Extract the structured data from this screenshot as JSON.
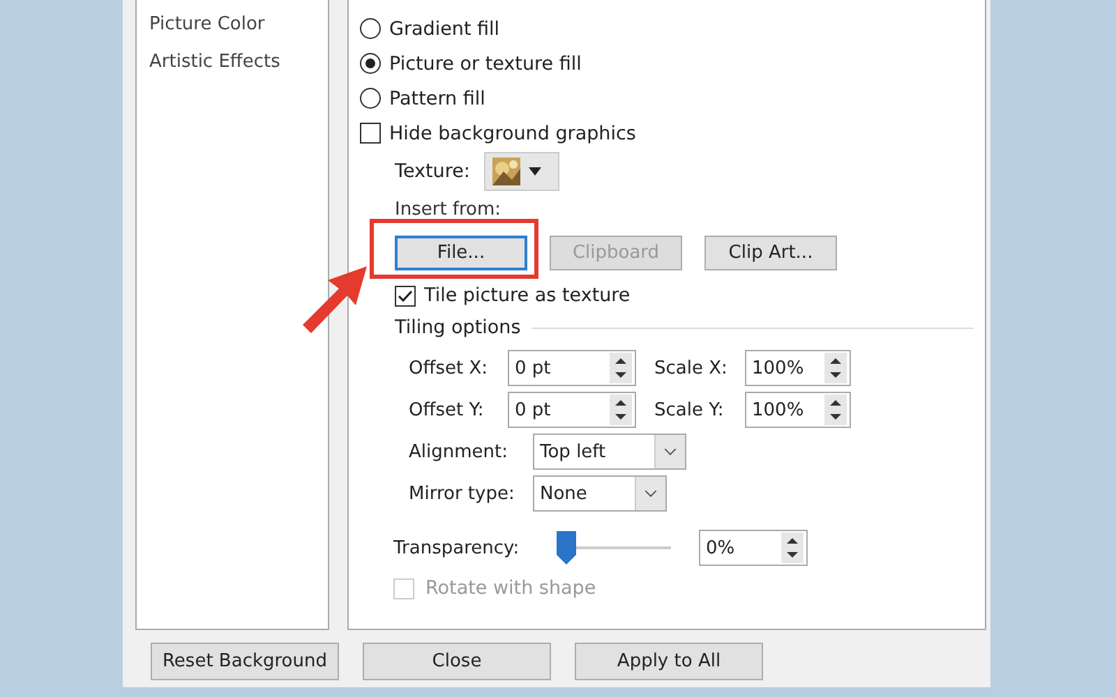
{
  "sidebar": {
    "items": [
      {
        "label": "Picture Color"
      },
      {
        "label": "Artistic Effects"
      }
    ]
  },
  "fill_options": [
    {
      "kind": "radio",
      "label": "Gradient fill",
      "selected": false
    },
    {
      "kind": "radio",
      "label": "Picture or texture fill",
      "selected": true
    },
    {
      "kind": "radio",
      "label": "Pattern fill",
      "selected": false
    },
    {
      "kind": "checkbox",
      "label": "Hide background graphics",
      "checked": false
    }
  ],
  "texture": {
    "label": "Texture:",
    "kind": "picture"
  },
  "insert_from": {
    "label": "Insert from:",
    "buttons": [
      {
        "label": "File...",
        "disabled": false,
        "focused": true,
        "annotated": true
      },
      {
        "label": "Clipboard",
        "disabled": true,
        "focused": false,
        "annotated": false
      },
      {
        "label": "Clip Art...",
        "disabled": false,
        "focused": false,
        "annotated": false
      }
    ]
  },
  "tile": {
    "label": "Tile picture as texture",
    "checked": true
  },
  "tiling": {
    "title": "Tiling options",
    "spinners": [
      {
        "label": "Offset X:",
        "value": "0 pt"
      },
      {
        "label": "Scale X:",
        "value": "100%"
      },
      {
        "label": "Offset Y:",
        "value": "0 pt"
      },
      {
        "label": "Scale Y:",
        "value": "100%"
      }
    ],
    "dropdowns": [
      {
        "label": "Alignment:",
        "value": "Top left"
      },
      {
        "label": "Mirror type:",
        "value": "None"
      }
    ]
  },
  "transparency": {
    "label": "Transparency:",
    "level": 0,
    "reading": "0%"
  },
  "rotate": {
    "label": "Rotate with shape",
    "checked": false,
    "disabled": true
  },
  "buttons": [
    "Reset Background",
    "Close",
    "Apply to All"
  ]
}
